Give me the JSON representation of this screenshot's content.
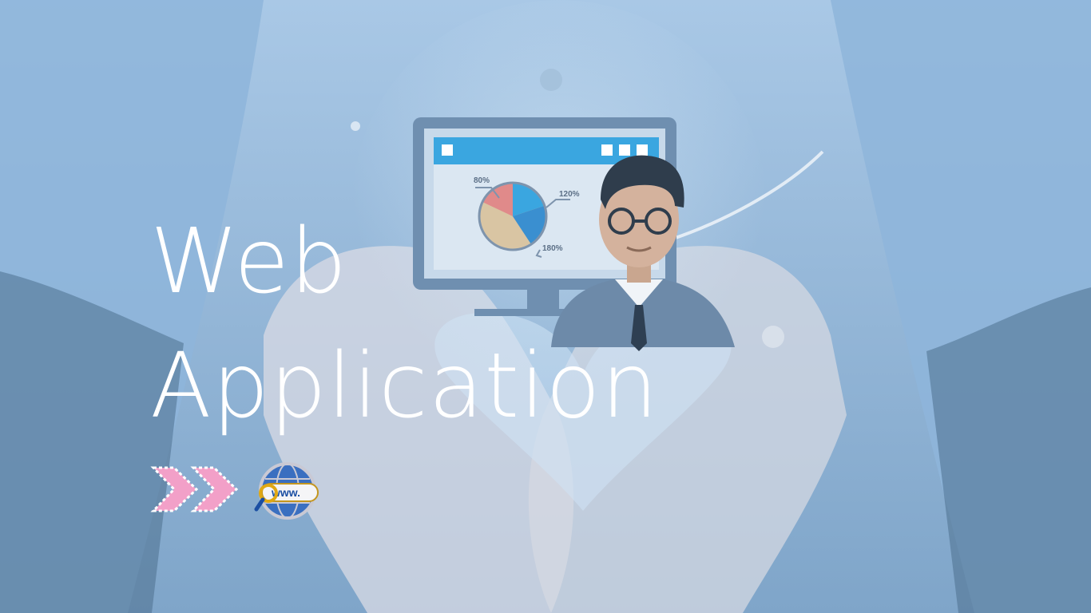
{
  "banner": {
    "title_line1": "Web",
    "title_line2": "Application"
  },
  "chart": {
    "labels": [
      "80%",
      "120%",
      "180%"
    ]
  },
  "globe": {
    "text": "www."
  },
  "colors": {
    "primary_text": "#ffffff",
    "accent_pink": "#f2a0c8",
    "monitor_frame": "#6f8fb0",
    "screen_header": "#3aa6e0"
  }
}
